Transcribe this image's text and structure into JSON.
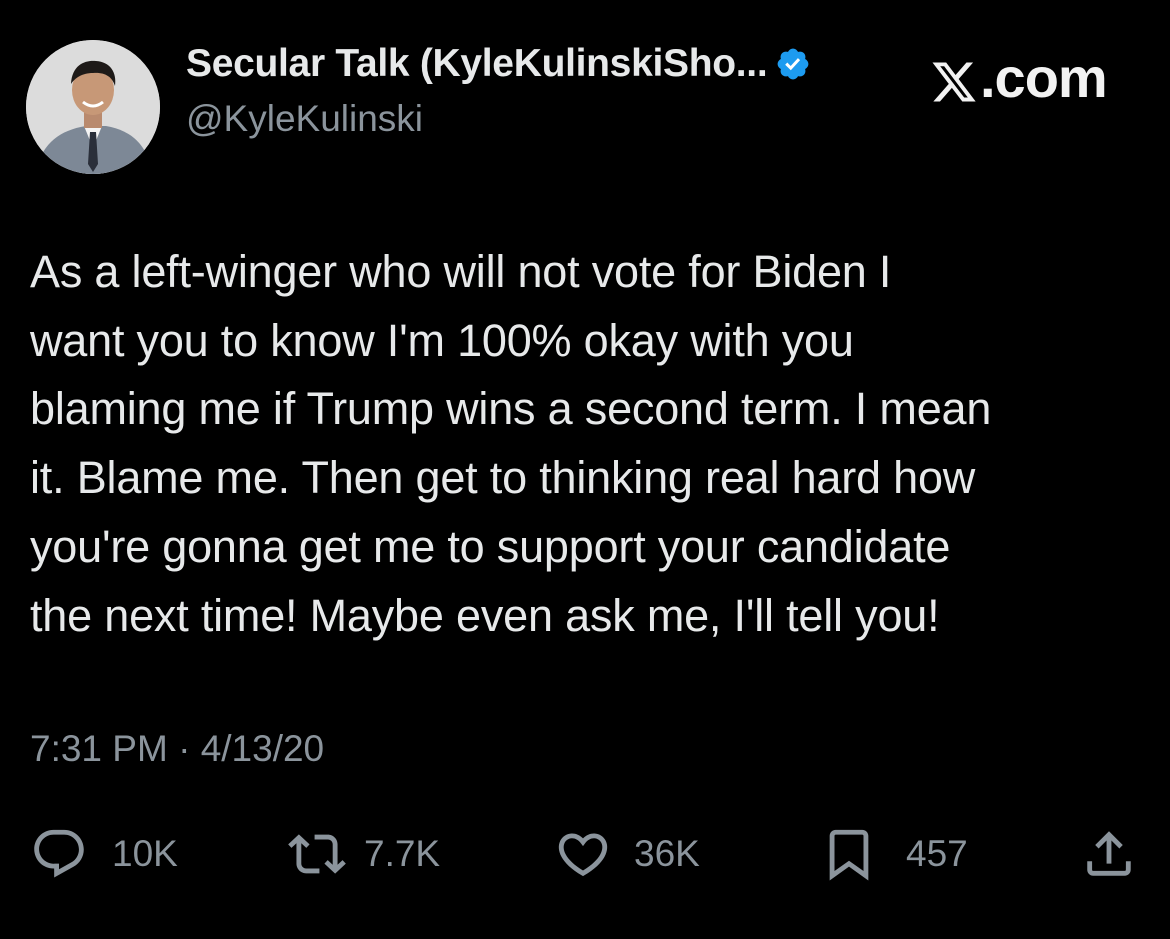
{
  "author": {
    "display_name": "Secular Talk (KyleKulinskiSho...",
    "handle": "@KyleKulinski",
    "avatar_icon": "profile-photo",
    "verified_icon": "verified-badge-icon",
    "verified_color": "#1d9bf0"
  },
  "brand": {
    "site_label": ".com",
    "logo_icon": "x-logo-icon"
  },
  "tweet": {
    "lines": [
      "As a left-winger who will not vote for Biden I",
      "want you to know I'm 100% okay with you",
      "blaming me if Trump wins a second term. I mean",
      "it. Blame me. Then get to thinking real hard how",
      "you're gonna get me to support your candidate",
      "the next time! Maybe even ask me, I'll tell you!"
    ],
    "time": "7:31 PM",
    "separator": "·",
    "date": "4/13/20"
  },
  "actions": {
    "reply": {
      "icon": "reply-icon",
      "count": "10K"
    },
    "retweet": {
      "icon": "retweet-icon",
      "count": "7.7K"
    },
    "like": {
      "icon": "heart-icon",
      "count": "36K"
    },
    "bookmark": {
      "icon": "bookmark-icon",
      "count": "457"
    },
    "share": {
      "icon": "share-icon"
    }
  },
  "colors": {
    "background": "#000000",
    "text": "#e7e9ea",
    "muted": "#8b949c"
  }
}
